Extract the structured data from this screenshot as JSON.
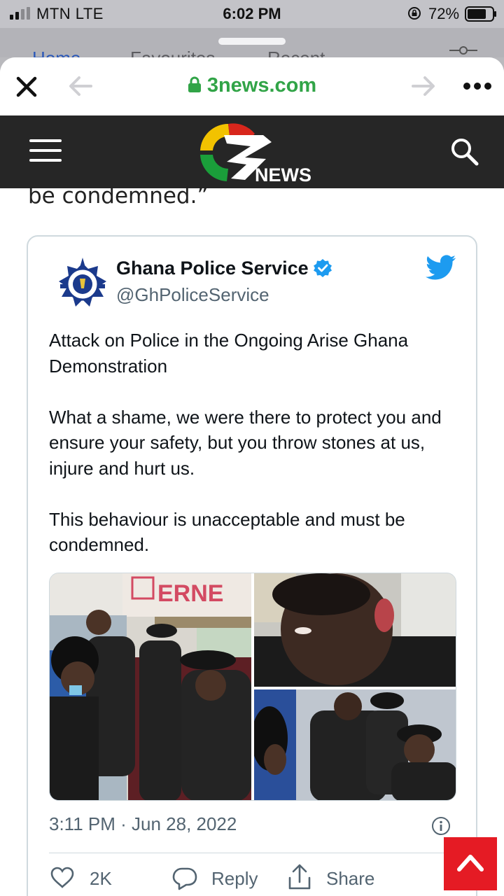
{
  "status_bar": {
    "carrier": "MTN  LTE",
    "time": "6:02 PM",
    "battery": "72%"
  },
  "background_app": {
    "tabs": [
      "Home",
      "Favourites",
      "Recent"
    ]
  },
  "browser": {
    "url": "3news.com"
  },
  "site": {
    "logo_text": "NEWS"
  },
  "article": {
    "tail_text": "be condemned.”"
  },
  "tweet": {
    "author_name": "Ghana Police Service",
    "handle": "@GhPoliceService",
    "paragraphs": [
      "Attack on Police in the Ongoing Arise Ghana Demonstration",
      "What a shame, we were there to protect you and ensure your safety, but you throw stones at us, injure and hurt us.",
      "This behaviour is unacceptable and must be condemned."
    ],
    "timestamp": "3:11 PM · Jun 28, 2022",
    "like_count": "2K",
    "reply_label": "Reply",
    "share_label": "Share",
    "photo_sign_text": "ERNE"
  },
  "colors": {
    "brand_green": "#31a447",
    "header_bg": "#262626",
    "twitter_blue": "#1d9bf0",
    "scroll_button": "#e51b24"
  }
}
